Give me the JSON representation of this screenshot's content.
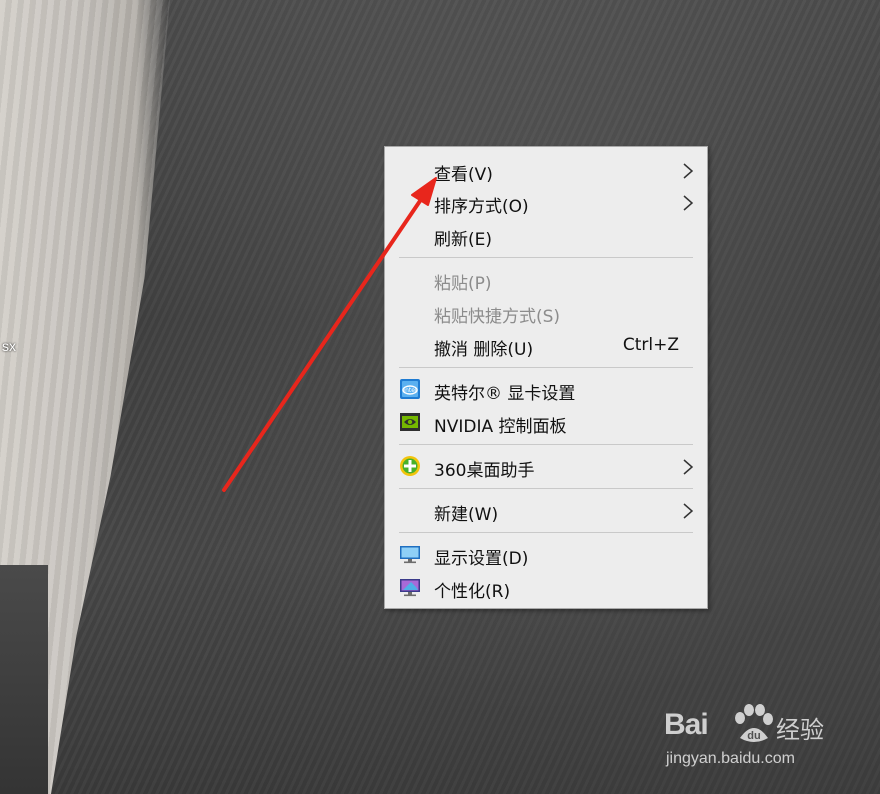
{
  "desktop": {
    "partial_label": "sx"
  },
  "context_menu": {
    "items": [
      {
        "label": "查看(V)",
        "has_submenu": true
      },
      {
        "label": "排序方式(O)",
        "has_submenu": true
      },
      {
        "label": "刷新(E)"
      },
      {
        "label": "粘贴(P)",
        "disabled": true
      },
      {
        "label": "粘贴快捷方式(S)",
        "disabled": true
      },
      {
        "label": "撤消 删除(U)",
        "shortcut": "Ctrl+Z"
      },
      {
        "label": "英特尔® 显卡设置",
        "icon": "intel-graphics-icon"
      },
      {
        "label": "NVIDIA 控制面板",
        "icon": "nvidia-icon"
      },
      {
        "label": "360桌面助手",
        "icon": "360-assistant-icon",
        "has_submenu": true
      },
      {
        "label": "新建(W)",
        "has_submenu": true
      },
      {
        "label": "显示设置(D)",
        "icon": "display-settings-icon"
      },
      {
        "label": "个性化(R)",
        "icon": "personalize-icon"
      }
    ]
  },
  "annotation": {
    "arrow_color": "#e8261c"
  },
  "watermark": {
    "brand": "Bai",
    "brand_suffix": "du",
    "cn": "经验",
    "url": "jingyan.baidu.com"
  }
}
